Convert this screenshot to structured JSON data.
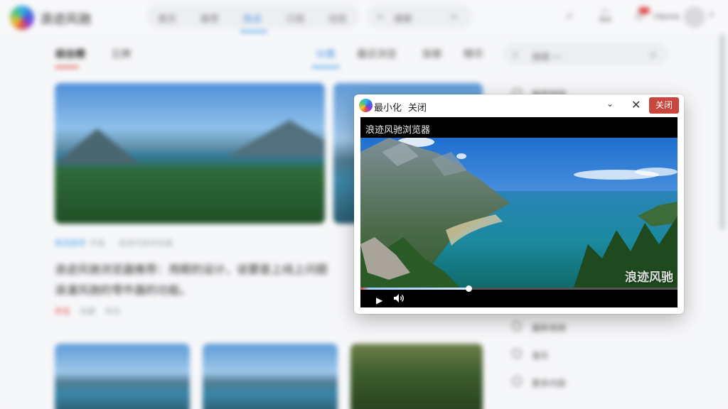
{
  "background": {
    "brand": {
      "name": "浪迹风驰",
      "logo_icon": "browser-logo-icon"
    },
    "nav": [
      "首页",
      "推荐",
      "热点",
      "订阅",
      "动态"
    ],
    "search_placeholder": "搜索",
    "user": {
      "name": "Hanna",
      "notification_badge": "99"
    },
    "subtabs_left": [
      "综合榜",
      "王牌"
    ],
    "subtabs_right": [
      "分类",
      "最近浏览",
      "探索",
      "精华"
    ],
    "sidebar_search_placeholder": "搜索 一",
    "feature": {
      "meta": [
        "精选推荐",
        "作者",
        "浪迹风驰浏览器"
      ],
      "title_lines": [
        "浪迹风驰浏览器推荐：用眼的设计，说要是上线上问题",
        "浪漫风驰的零件器的功能。"
      ],
      "footer": [
        "转发",
        "收藏",
        "转自"
      ]
    },
    "sidebar_items": [
      "推荐视频",
      "最新视频",
      "音乐",
      "更多内容"
    ],
    "colors": {
      "accent_red": "#c9453d",
      "accent_blue": "#5aa7ee"
    }
  },
  "mini_player": {
    "title_buttons": {
      "minimize": "最小化",
      "close_text": "关闭"
    },
    "icons": {
      "logo": "browser-logo-icon",
      "dropdown": "chevron-down-icon",
      "close": "close-icon"
    },
    "close_button_label": "关闭",
    "video_title": "浪迹风驰浏览器",
    "watermark": "浪迹风驰",
    "progress": 0.34,
    "controls": {
      "play": "play-icon",
      "volume": "volume-icon"
    }
  }
}
